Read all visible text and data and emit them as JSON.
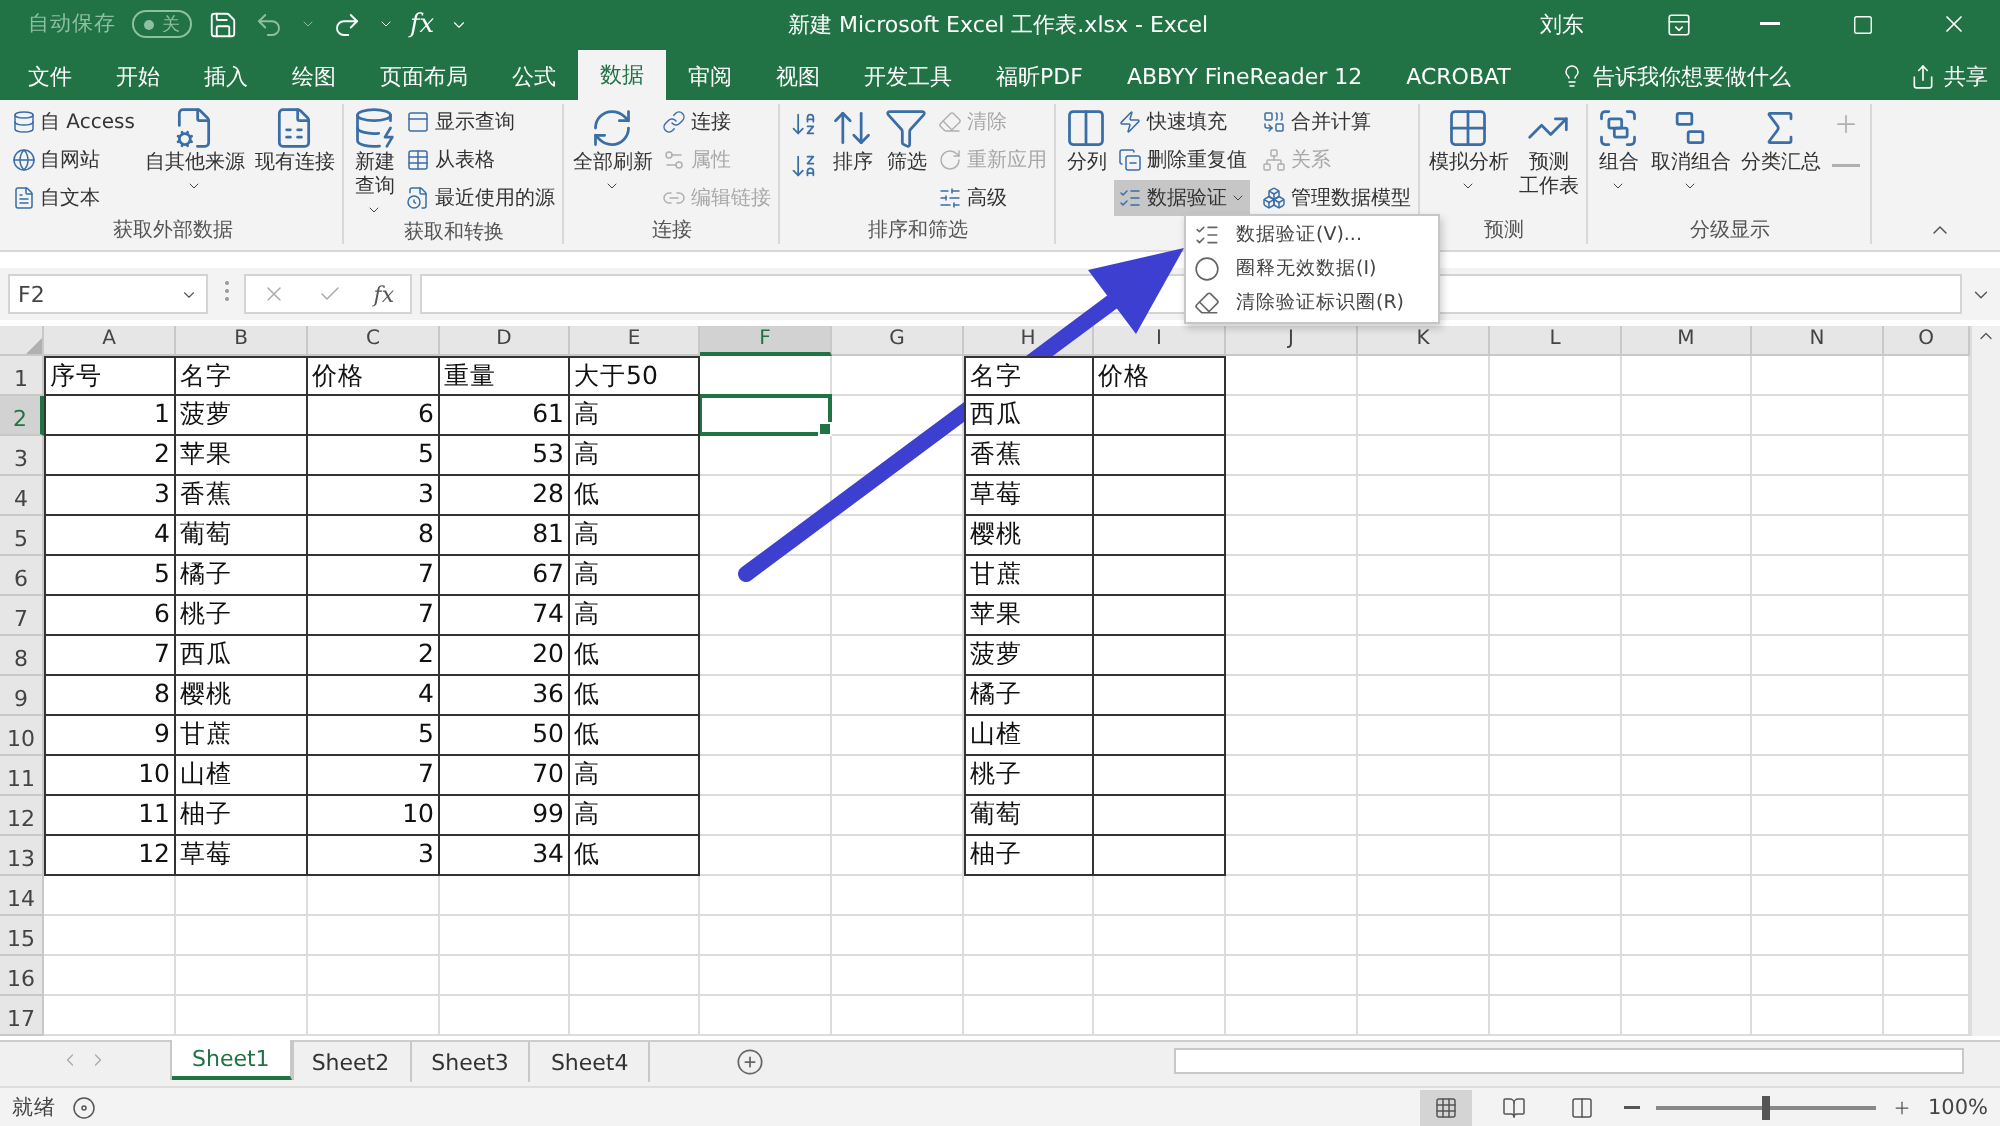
{
  "title_bar": {
    "autosave_label": "自动保存",
    "autosave": {
      "on": false,
      "text": "关"
    },
    "fx": "fx",
    "title": "新建 Microsoft Excel 工作表.xlsx  -  Excel",
    "user": "刘东"
  },
  "tabs": [
    {
      "label": "文件",
      "selected": false
    },
    {
      "label": "开始",
      "selected": false
    },
    {
      "label": "插入",
      "selected": false
    },
    {
      "label": "绘图",
      "selected": false
    },
    {
      "label": "页面布局",
      "selected": false
    },
    {
      "label": "公式",
      "selected": false
    },
    {
      "label": "数据",
      "selected": true
    },
    {
      "label": "审阅",
      "selected": false
    },
    {
      "label": "视图",
      "selected": false
    },
    {
      "label": "开发工具",
      "selected": false
    },
    {
      "label": "福昕PDF",
      "selected": false
    },
    {
      "label": "ABBYY FineReader 12",
      "selected": false
    },
    {
      "label": "ACROBAT",
      "selected": false
    }
  ],
  "tell_me": "告诉我你想要做什么",
  "share": "共享",
  "ribbon": {
    "groups": [
      {
        "title": "获取外部数据",
        "items": [
          {
            "kind": "small",
            "label": "自 Access",
            "disabled": false
          },
          {
            "kind": "small",
            "label": "自网站",
            "disabled": false
          },
          {
            "kind": "small",
            "label": "自文本",
            "disabled": false
          },
          {
            "kind": "large_menu",
            "label": "自其他来源",
            "disabled": false
          },
          {
            "kind": "large",
            "label": "现有连接",
            "disabled": false
          }
        ]
      },
      {
        "title": "获取和转换",
        "items": [
          {
            "kind": "large_menu",
            "label_lines": [
              "新建",
              "查询"
            ],
            "disabled": false
          },
          {
            "kind": "small",
            "label": "显示查询",
            "disabled": false
          },
          {
            "kind": "small",
            "label": "从表格",
            "disabled": false
          },
          {
            "kind": "small",
            "label": "最近使用的源",
            "disabled": false
          }
        ]
      },
      {
        "title": "连接",
        "items": [
          {
            "kind": "large_menu",
            "label": "全部刷新",
            "disabled": false
          },
          {
            "kind": "small",
            "label": "连接",
            "disabled": false
          },
          {
            "kind": "small",
            "label": "属性",
            "disabled": true
          },
          {
            "kind": "small",
            "label": "编辑链接",
            "disabled": true
          }
        ]
      },
      {
        "title": "排序和筛选",
        "items": [
          {
            "kind": "icon",
            "disabled": false
          },
          {
            "kind": "icon",
            "disabled": false
          },
          {
            "kind": "large",
            "label": "排序",
            "disabled": false
          },
          {
            "kind": "large",
            "label": "筛选",
            "disabled": false
          },
          {
            "kind": "small",
            "label": "清除",
            "disabled": true
          },
          {
            "kind": "small",
            "label": "重新应用",
            "disabled": true
          },
          {
            "kind": "small",
            "label": "高级",
            "disabled": false
          }
        ]
      },
      {
        "items": [
          {
            "kind": "large",
            "label": "分列",
            "disabled": false
          },
          {
            "kind": "small",
            "label": "快速填充",
            "disabled": false
          },
          {
            "kind": "small",
            "label": "合并计算",
            "disabled": false
          },
          {
            "kind": "small",
            "label": "删除重复值",
            "disabled": false
          },
          {
            "kind": "small",
            "label": "关系",
            "disabled": true
          },
          {
            "kind": "small_menu",
            "label": "数据验证",
            "disabled": false,
            "menu": {
              "open": true,
              "items": [
                "数据验证(V)...",
                "圈释无效数据(I)",
                "清除验证标识圈(R)"
              ]
            }
          },
          {
            "kind": "small",
            "label": "管理数据模型",
            "disabled": false
          }
        ]
      },
      {
        "title": "预测",
        "items": [
          {
            "kind": "large_menu",
            "label": "模拟分析",
            "disabled": false
          },
          {
            "kind": "large",
            "label_lines": [
              "预测",
              "工作表"
            ],
            "disabled": false
          }
        ]
      },
      {
        "title": "分级显示",
        "items": [
          {
            "kind": "large_menu",
            "label": "组合",
            "disabled": false
          },
          {
            "kind": "large_menu",
            "label": "取消组合",
            "disabled": false
          },
          {
            "kind": "large",
            "label": "分类汇总",
            "disabled": false
          },
          {
            "kind": "icon",
            "disabled": true
          },
          {
            "kind": "icon",
            "disabled": true
          }
        ]
      }
    ]
  },
  "formula_bar": {
    "name_box": "F2",
    "fx": "fx"
  },
  "sheet": {
    "columns": [
      {
        "letter": "A",
        "selected": false
      },
      {
        "letter": "B",
        "selected": false
      },
      {
        "letter": "C",
        "selected": false
      },
      {
        "letter": "D",
        "selected": false
      },
      {
        "letter": "E",
        "selected": false
      },
      {
        "letter": "F",
        "selected": true
      },
      {
        "letter": "G",
        "selected": false
      },
      {
        "letter": "H",
        "selected": false
      },
      {
        "letter": "I",
        "selected": false
      },
      {
        "letter": "J",
        "selected": false
      },
      {
        "letter": "K",
        "selected": false
      },
      {
        "letter": "L",
        "selected": false
      },
      {
        "letter": "M",
        "selected": false
      },
      {
        "letter": "N",
        "selected": false
      },
      {
        "letter": "O",
        "selected": false
      }
    ],
    "rows": [
      {
        "number": "1",
        "selected": false
      },
      {
        "number": "2",
        "selected": true
      },
      {
        "number": "3",
        "selected": false
      },
      {
        "number": "4",
        "selected": false
      },
      {
        "number": "5",
        "selected": false
      },
      {
        "number": "6",
        "selected": false
      },
      {
        "number": "7",
        "selected": false
      },
      {
        "number": "8",
        "selected": false
      },
      {
        "number": "9",
        "selected": false
      },
      {
        "number": "10",
        "selected": false
      },
      {
        "number": "11",
        "selected": false
      },
      {
        "number": "12",
        "selected": false
      },
      {
        "number": "13",
        "selected": false
      },
      {
        "number": "14",
        "selected": false
      },
      {
        "number": "15",
        "selected": false
      },
      {
        "number": "16",
        "selected": false
      },
      {
        "number": "17",
        "selected": false
      }
    ],
    "left_table": {
      "columns": [
        {
          "header": "序号",
          "numeric": true
        },
        {
          "header": "名字",
          "numeric": false
        },
        {
          "header": "价格",
          "numeric": true
        },
        {
          "header": "重量",
          "numeric": true
        },
        {
          "header": "大于50",
          "numeric": false
        }
      ],
      "rows": [
        [
          "1",
          "菠萝",
          "6",
          "61",
          "高"
        ],
        [
          "2",
          "苹果",
          "5",
          "53",
          "高"
        ],
        [
          "3",
          "香蕉",
          "3",
          "28",
          "低"
        ],
        [
          "4",
          "葡萄",
          "8",
          "81",
          "高"
        ],
        [
          "5",
          "橘子",
          "7",
          "67",
          "高"
        ],
        [
          "6",
          "桃子",
          "7",
          "74",
          "高"
        ],
        [
          "7",
          "西瓜",
          "2",
          "20",
          "低"
        ],
        [
          "8",
          "樱桃",
          "4",
          "36",
          "低"
        ],
        [
          "9",
          "甘蔗",
          "5",
          "50",
          "低"
        ],
        [
          "10",
          "山楂",
          "7",
          "70",
          "高"
        ],
        [
          "11",
          "柚子",
          "10",
          "99",
          "高"
        ],
        [
          "12",
          "草莓",
          "3",
          "34",
          "低"
        ]
      ]
    },
    "right_table": {
      "headers": [
        "名字",
        "价格"
      ],
      "rows": [
        "西瓜",
        "香蕉",
        "草莓",
        "樱桃",
        "甘蔗",
        "苹果",
        "菠萝",
        "橘子",
        "山楂",
        "桃子",
        "葡萄",
        "柚子"
      ]
    }
  },
  "sheet_tabs": [
    {
      "label": "Sheet1",
      "selected": true
    },
    {
      "label": "Sheet2",
      "selected": false
    },
    {
      "label": "Sheet3",
      "selected": false
    },
    {
      "label": "Sheet4",
      "selected": false
    }
  ],
  "status_bar": {
    "status": "就绪",
    "zoom": {
      "level": 0.5,
      "text": "100%"
    }
  }
}
